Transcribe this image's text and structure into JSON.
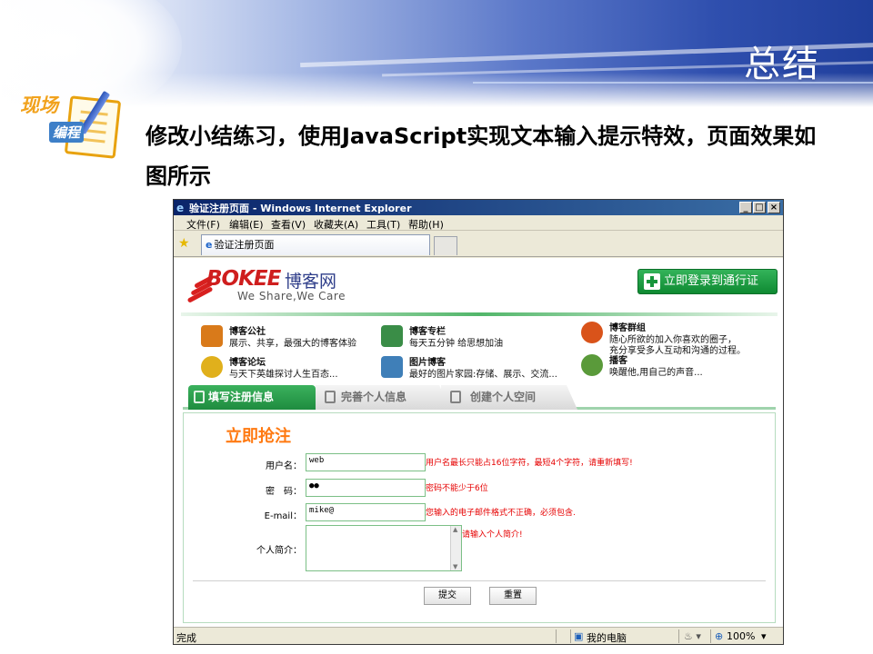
{
  "slide": {
    "title": "总结",
    "badge": {
      "line1": "现场",
      "line2": "编程"
    },
    "intro": "修改小结练习，使用JavaScript实现文本输入提示特效，页面效果如图所示"
  },
  "browser": {
    "title": "验证注册页面 - Windows Internet Explorer",
    "controls": [
      "_",
      "□",
      "×"
    ],
    "menu": [
      "文件(F)",
      "编辑(E)",
      "查看(V)",
      "收藏夹(A)",
      "工具(T)",
      "帮助(H)"
    ],
    "tab_title": "验证注册页面",
    "status": {
      "left": "完成",
      "zone": "我的电脑",
      "zoom": "100%"
    }
  },
  "page": {
    "logo": {
      "brand": "BOKEE",
      "cn": "博客网",
      "slogan": "We Share,We Care"
    },
    "login_button": "立即登录到通行证",
    "features": [
      {
        "title": "博客公社",
        "desc": "展示、共享，最强大的博客体验",
        "desc2": "",
        "color": "#d97a1a"
      },
      {
        "title": "博客专栏",
        "desc": "每天五分钟 给思想加油",
        "desc2": "",
        "color": "#3a8d47"
      },
      {
        "title": "博客群组",
        "desc": "随心所欲的加入你喜欢的圈子，",
        "desc2": "充分享受多人互动和沟通的过程。",
        "color": "#d9531a"
      },
      {
        "title": "博客论坛",
        "desc": "与天下英雄探讨人生百态...",
        "desc2": "",
        "color": "#e0b01c"
      },
      {
        "title": "图片博客",
        "desc": "最好的图片家园:存储、展示、交流...",
        "desc2": "",
        "color": "#3f7fb8"
      },
      {
        "title": "播客",
        "desc": "唤醒他,用自己的声音...",
        "desc2": "",
        "color": "#5a9a3a"
      }
    ],
    "steps": [
      "填写注册信息",
      "完善个人信息",
      "创建个人空间"
    ],
    "form": {
      "title": "立即抢注",
      "username_label": "用户名：",
      "username_value": "web",
      "username_error": "用户名最长只能占16位字符，最短4个字符，请重新填写!",
      "password_label": "密　码：",
      "password_value": "●●",
      "password_error": "密码不能少于6位",
      "email_label": "E-mail：",
      "email_value": "mike@",
      "email_error": "您输入的电子邮件格式不正确，必须包含.",
      "intro_label": "个人简介：",
      "intro_error": "请输入个人简介!",
      "submit": "提交",
      "reset": "重置"
    }
  }
}
